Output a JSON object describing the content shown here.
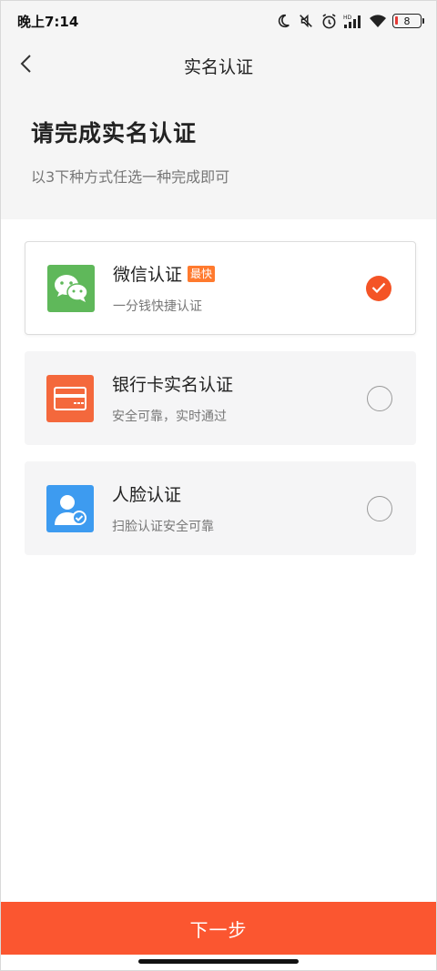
{
  "status_bar": {
    "time": "晚上7:14",
    "battery": "8",
    "icons": [
      "moon-icon",
      "mute-icon",
      "alarm-icon",
      "hd-signal-icon",
      "wifi-icon",
      "battery-icon"
    ]
  },
  "nav": {
    "title": "实名认证",
    "back_icon": "chevron-left-icon"
  },
  "header": {
    "title": "请完成实名认证",
    "subtitle": "以3下种方式任选一种完成即可"
  },
  "options": [
    {
      "title": "微信认证",
      "badge": "最快",
      "desc": "一分钱快捷认证",
      "icon": "wechat-icon",
      "icon_bg": "#5fb85a",
      "selected": true
    },
    {
      "title": "银行卡实名认证",
      "desc": "安全可靠，实时通过",
      "icon": "bank-card-icon",
      "icon_bg": "#f4683c",
      "selected": false
    },
    {
      "title": "人脸认证",
      "desc": "扫脸认证安全可靠",
      "icon": "face-verify-icon",
      "icon_bg": "#3d9bf0",
      "selected": false
    }
  ],
  "footer": {
    "next_label": "下一步"
  },
  "colors": {
    "accent": "#fb5630",
    "header_bg": "#f5f5f5"
  }
}
